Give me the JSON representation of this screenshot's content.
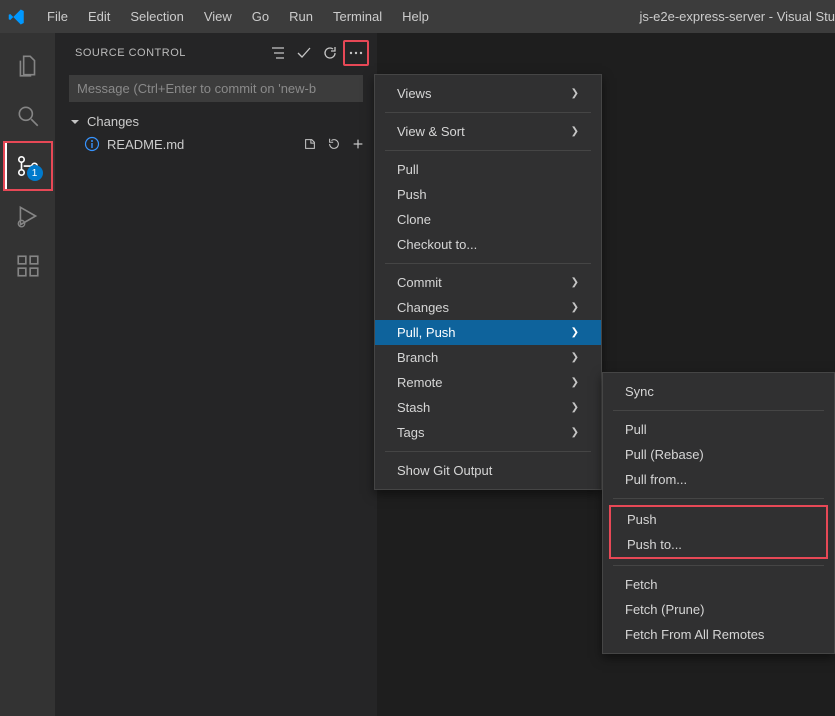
{
  "app": {
    "windowTitle": "js-e2e-express-server - Visual Stu",
    "menu": [
      "File",
      "Edit",
      "Selection",
      "View",
      "Go",
      "Run",
      "Terminal",
      "Help"
    ]
  },
  "activityBar": {
    "badge": "1"
  },
  "sidebar": {
    "title": "SOURCE CONTROL",
    "messagePlaceholder": "Message (Ctrl+Enter to commit on 'new-b",
    "changesLabel": "Changes",
    "file": "README.md"
  },
  "contextMenu": {
    "views": "Views",
    "viewSort": "View & Sort",
    "pull": "Pull",
    "push": "Push",
    "clone": "Clone",
    "checkout": "Checkout to...",
    "commit": "Commit",
    "changes": "Changes",
    "pullPush": "Pull, Push",
    "branch": "Branch",
    "remote": "Remote",
    "stash": "Stash",
    "tags": "Tags",
    "showOutput": "Show Git Output"
  },
  "submenu": {
    "sync": "Sync",
    "pull": "Pull",
    "pullRebase": "Pull (Rebase)",
    "pullFrom": "Pull from...",
    "push": "Push",
    "pushTo": "Push to...",
    "fetch": "Fetch",
    "fetchPrune": "Fetch (Prune)",
    "fetchAll": "Fetch From All Remotes"
  }
}
